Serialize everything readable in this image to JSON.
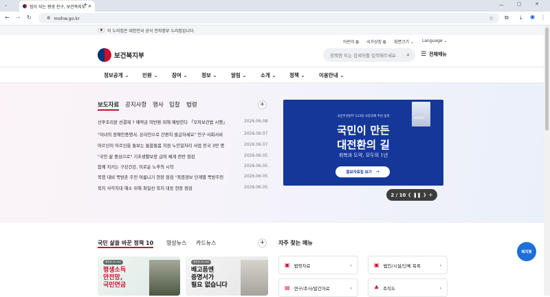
{
  "browser": {
    "tab_title": "힘이 되는 평생 친구, 보건복지부",
    "url": "mohw.go.kr"
  },
  "gov_banner": "이 누리집은 대한민국 공식 전자정부 누리집입니다.",
  "utility": {
    "links": [
      "어린이",
      "국가상징",
      "화면크기",
      "Language"
    ]
  },
  "header": {
    "logo_text": "보건복지부",
    "search_placeholder": "정책명 또는 검색어를 입력해주세요",
    "all_menu": "전체메뉴"
  },
  "gnb": [
    "정보공개",
    "민원",
    "참여",
    "정보",
    "알림",
    "소개",
    "정책",
    "이용안내"
  ],
  "news": {
    "tabs": [
      "보도자료",
      "공지사항",
      "행사",
      "입찰",
      "법령"
    ],
    "items": [
      {
        "title": "산후조리원 선결제 ? 예약금 미반환 피해 예방한다 「모자보건법 시행」",
        "date": "2026.06.08"
      },
      {
        "title": "\"자녀의 장애인증명서, 온라인으로 간편히 발급하세요\" 인구·사회서비",
        "date": "2026.06.07"
      },
      {
        "title": "어르신이 어르신을 돌보는 통합돌봄 지원 노인일자리 사업 전국 3만 명",
        "date": "2026.06.07"
      },
      {
        "title": "\"국민 삶 중심으로\" 기초생활보장 급여 체계 전반 점검",
        "date": "2026.06.05"
      },
      {
        "title": "함께 지키는 구강건강, 이로운 노후의 시작",
        "date": "2026.06.05"
      },
      {
        "title": "폭염 대비 쪽방촌 주민 여름나기 현장 점검 \"폭염경보 단계별 쪽방주민",
        "date": "2026.06.05"
      },
      {
        "title": "복지 사각지대 해소 위해 최일선 복지 대응 현장 점검",
        "date": "2026.06.05"
      }
    ]
  },
  "banner": {
    "eyebrow": "국민주권정부 123대 국정과제 추진 실적",
    "line1": "국민이 만든",
    "line2": "대전환의 길",
    "sub": "회복과 도약, 모두의 1년",
    "button": "홍보자료집 보기",
    "book_label": "2026년"
  },
  "pager": {
    "current": "2",
    "total": "10"
  },
  "policy": {
    "tabs": [
      "국민 삶을 바꾼 정책 10",
      "영상뉴스",
      "카드뉴스"
    ],
    "cards": [
      {
        "tag": "제지부-25-002",
        "text": "평생소득\n안전망,\n국민연금"
      },
      {
        "tag": "제지부-25-005",
        "text": "배고픔엔\n증명서가\n필요 없습니다"
      }
    ]
  },
  "quick": {
    "title": "자주 찾는 메뉴",
    "items": [
      "법령자료",
      "법인/시설/단체 목록",
      "연구/조사/발간자료",
      "조직도"
    ]
  },
  "chatbot_label": "복지봇",
  "colors": {
    "accent": "#c8102e",
    "navy": "#003478",
    "banner_bg": "#15379a"
  }
}
